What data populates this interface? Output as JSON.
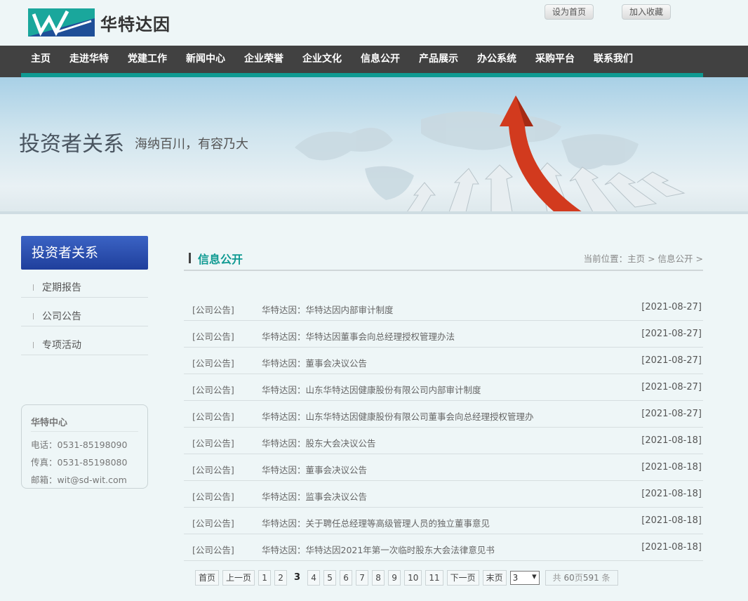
{
  "header": {
    "logo_text": "华特达因",
    "btn_home": "设为首页",
    "btn_fav": "加入收藏"
  },
  "nav": [
    "主页",
    "走进华特",
    "党建工作",
    "新闻中心",
    "企业荣誉",
    "企业文化",
    "信息公开",
    "产品展示",
    "办公系统",
    "采购平台",
    "联系我们"
  ],
  "banner": {
    "title": "投资者关系",
    "subtitle": "海纳百川，有容乃大"
  },
  "sidebar": {
    "heading": "投资者关系",
    "items": [
      "定期报告",
      "公司公告",
      "专项活动"
    ],
    "contact": {
      "title": "华特中心",
      "phone": "电话：0531-85198090",
      "fax": "传真：0531-85198080",
      "email": "邮箱：wit@sd-wit.com"
    }
  },
  "main": {
    "title": "信息公开",
    "breadcrumb": "当前位置：主页 > 信息公开 >",
    "rows": [
      {
        "cat": "[公司公告]",
        "title": "华特达因：华特达因内部审计制度",
        "date": "[2021-08-27]"
      },
      {
        "cat": "[公司公告]",
        "title": "华特达因：华特达因董事会向总经理授权管理办法",
        "date": "[2021-08-27]"
      },
      {
        "cat": "[公司公告]",
        "title": "华特达因：董事会决议公告",
        "date": "[2021-08-27]"
      },
      {
        "cat": "[公司公告]",
        "title": "华特达因：山东华特达因健康股份有限公司内部审计制度",
        "date": "[2021-08-27]"
      },
      {
        "cat": "[公司公告]",
        "title": "华特达因：山东华特达因健康股份有限公司董事会向总经理授权管理办",
        "date": "[2021-08-27]"
      },
      {
        "cat": "[公司公告]",
        "title": "华特达因：股东大会决议公告",
        "date": "[2021-08-18]"
      },
      {
        "cat": "[公司公告]",
        "title": "华特达因：董事会决议公告",
        "date": "[2021-08-18]"
      },
      {
        "cat": "[公司公告]",
        "title": "华特达因：监事会决议公告",
        "date": "[2021-08-18]"
      },
      {
        "cat": "[公司公告]",
        "title": "华特达因：关于聘任总经理等高级管理人员的独立董事意见",
        "date": "[2021-08-18]"
      },
      {
        "cat": "[公司公告]",
        "title": "华特达因：华特达因2021年第一次临时股东大会法律意见书",
        "date": "[2021-08-18]"
      }
    ]
  },
  "pager": {
    "first": "首页",
    "prev": "上一页",
    "pages": [
      "1",
      "2",
      "3",
      "4",
      "5",
      "6",
      "7",
      "8",
      "9",
      "10",
      "11"
    ],
    "current": "3",
    "next": "下一页",
    "last": "末页",
    "select_value": "3",
    "total_prefix": "共",
    "total_pages": "60",
    "total_mid": "页",
    "total_items": "591",
    "total_suffix": "条"
  },
  "colors": {
    "accent": "#0f9a92",
    "nav_bg": "#414141",
    "sidebar_head": "#2a4fb0"
  }
}
